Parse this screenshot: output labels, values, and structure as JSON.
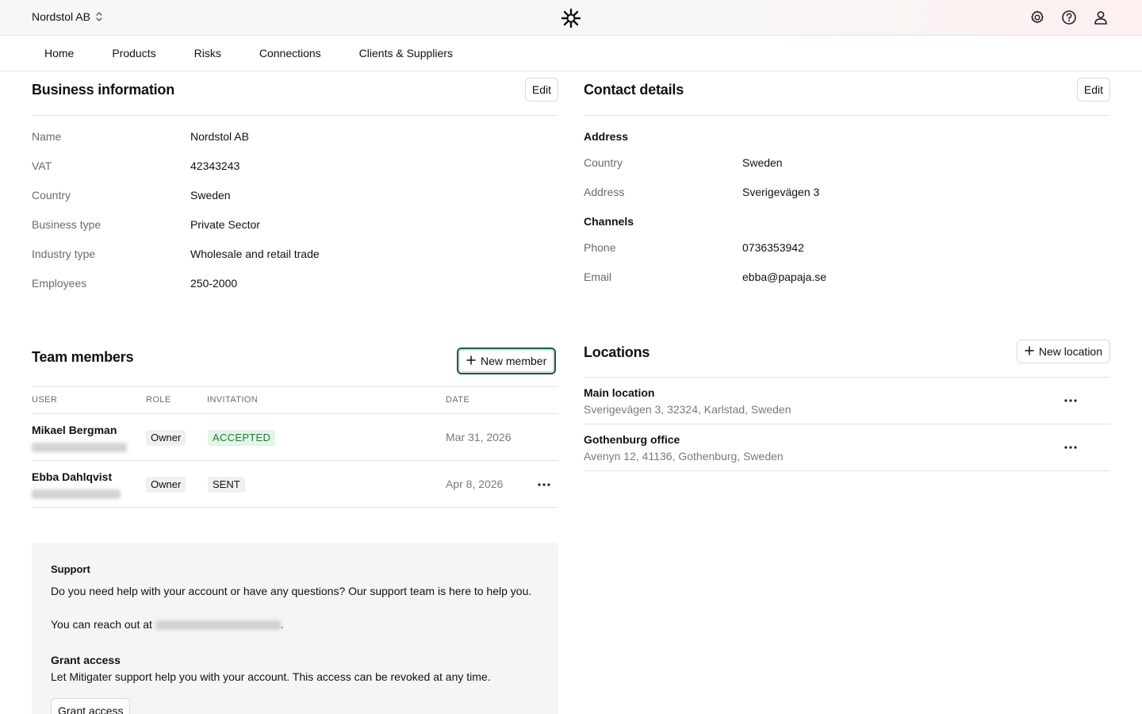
{
  "topbar": {
    "org_name": "Nordstol AB",
    "icons": [
      "settings-icon",
      "help-icon",
      "user-icon"
    ]
  },
  "nav": {
    "items": [
      "Home",
      "Products",
      "Risks",
      "Connections",
      "Clients & Suppliers"
    ]
  },
  "business": {
    "title": "Business information",
    "edit_label": "Edit",
    "fields": [
      {
        "label": "Name",
        "value": "Nordstol AB"
      },
      {
        "label": "VAT",
        "value": "42343243"
      },
      {
        "label": "Country",
        "value": "Sweden"
      },
      {
        "label": "Business type",
        "value": "Private Sector"
      },
      {
        "label": "Industry type",
        "value": "Wholesale and retail trade"
      },
      {
        "label": "Employees",
        "value": "250-2000"
      }
    ]
  },
  "contact": {
    "title": "Contact details",
    "edit_label": "Edit",
    "address_heading": "Address",
    "country_label": "Country",
    "country_value": "Sweden",
    "address_label": "Address",
    "address_value": "Sverigevägen 3",
    "channels_heading": "Channels",
    "phone_label": "Phone",
    "phone_value": "0736353942",
    "email_label": "Email",
    "email_value": "ebba@papaja.se"
  },
  "team": {
    "title": "Team members",
    "new_member_label": "New member",
    "columns": [
      "USER",
      "ROLE",
      "INVITATION",
      "DATE"
    ],
    "rows": [
      {
        "user": "Mikael Bergman",
        "role": "Owner",
        "invitation": "ACCEPTED",
        "date": "Mar 31, 2026"
      },
      {
        "user": "Ebba Dahlqvist",
        "role": "Owner",
        "invitation": "SENT",
        "date": "Apr 8, 2026"
      }
    ]
  },
  "locations": {
    "title": "Locations",
    "new_location_label": "New location",
    "items": [
      {
        "name": "Main location",
        "address": "Sverigevägen 3, 32324, Karlstad, Sweden"
      },
      {
        "name": "Gothenburg office",
        "address": "Avenyn 12, 41136, Gothenburg, Sweden"
      }
    ]
  },
  "support": {
    "title": "Support",
    "text": "Do you need help with your account or have any questions? Our support team is here to help you.",
    "reach_prefix": "You can reach out at",
    "reach_suffix": ".",
    "grant_heading": "Grant access",
    "grant_text": "Let Mitigater support help you with your account. This access can be revoked at any time.",
    "grant_button": "Grant access"
  },
  "colors": {
    "accent_green": "#1e7a3a",
    "focus_ring": "#1f5c45"
  }
}
